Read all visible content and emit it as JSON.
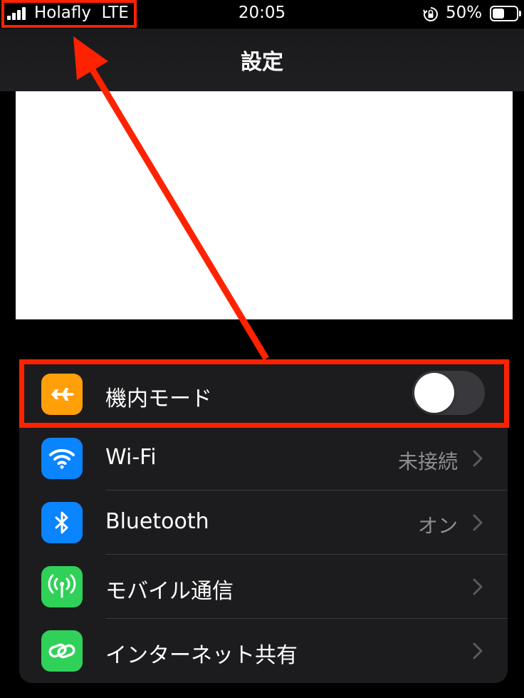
{
  "status_bar": {
    "carrier": "Holafly  LTE",
    "time": "20:05",
    "battery_percent": "50%",
    "battery_level": 0.5
  },
  "nav": {
    "title": "設定"
  },
  "settings": {
    "rows": [
      {
        "label": "機内モード",
        "icon": "airplane-icon",
        "icon_color": "#ff9f0a",
        "toggle_on": false
      },
      {
        "label": "Wi-Fi",
        "value": "未接続",
        "icon": "wifi-icon",
        "icon_color": "#0a84ff"
      },
      {
        "label": "Bluetooth",
        "value": "オン",
        "icon": "bluetooth-icon",
        "icon_color": "#0a84ff"
      },
      {
        "label": "モバイル通信",
        "icon": "antenna-icon",
        "icon_color": "#30d158"
      },
      {
        "label": "インターネット共有",
        "icon": "link-icon",
        "icon_color": "#30d158"
      }
    ]
  },
  "colors": {
    "annotation": "#ff2200",
    "background": "#000000",
    "group_background": "#1c1c1e",
    "secondary_text": "#8d8d93"
  }
}
